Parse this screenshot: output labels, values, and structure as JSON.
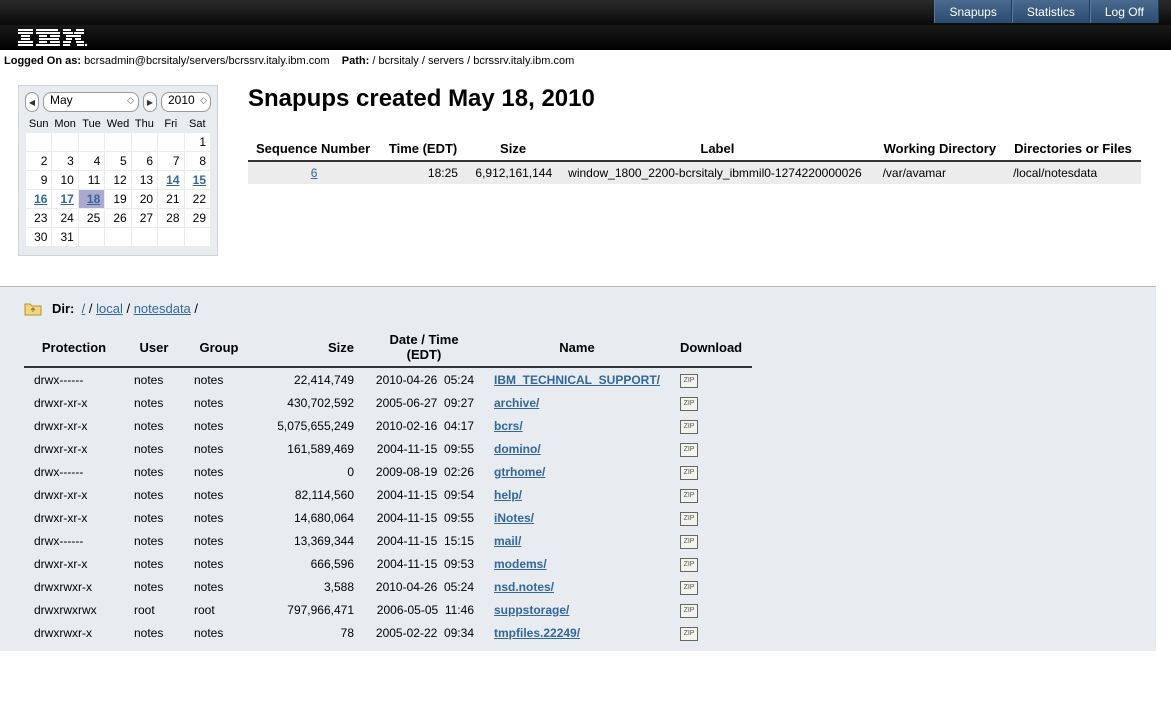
{
  "topnav": {
    "snapups": "Snapups",
    "statistics": "Statistics",
    "logoff": "Log Off"
  },
  "infobar": {
    "logged_label": "Logged On as:",
    "logged_value": "bcrsadmin@bcrsitaly/servers/bcrssrv.italy.ibm.com",
    "path_label": "Path:",
    "path_value": "/ bcrsitaly / servers / bcrssrv.italy.ibm.com"
  },
  "calendar": {
    "month": "May",
    "year": "2010",
    "days": [
      "Sun",
      "Mon",
      "Tue",
      "Wed",
      "Thu",
      "Fri",
      "Sat"
    ],
    "weeks": [
      [
        "",
        "",
        "",
        "",
        "",
        "",
        "1"
      ],
      [
        "2",
        "3",
        "4",
        "5",
        "6",
        "7",
        "8"
      ],
      [
        "9",
        "10",
        "11",
        "12",
        "13",
        "14",
        "15"
      ],
      [
        "16",
        "17",
        "18",
        "19",
        "20",
        "21",
        "22"
      ],
      [
        "23",
        "24",
        "25",
        "26",
        "27",
        "28",
        "29"
      ],
      [
        "30",
        "31",
        "",
        "",
        "",
        "",
        ""
      ]
    ],
    "linked": [
      "14",
      "15",
      "16",
      "17",
      "18"
    ],
    "selected": "18"
  },
  "snapups": {
    "title": "Snapups created May 18, 2010",
    "headers": {
      "seq": "Sequence Number",
      "time": "Time (EDT)",
      "size": "Size",
      "label": "Label",
      "workdir": "Working Directory",
      "dirs": "Directories or Files"
    },
    "rows": [
      {
        "seq": "6",
        "time": "18:25",
        "size": "6,912,161,144",
        "label": "window_1800_2200-bcrsitaly_ibmmil0-1274220000026",
        "workdir": "/var/avamar",
        "dirs": "/local/notesdata"
      }
    ]
  },
  "filebrowser": {
    "dir_label": "Dir:",
    "breadcrumb": [
      {
        "text": "/",
        "link": true
      },
      {
        "text": "/",
        "link": false
      },
      {
        "text": "local",
        "link": true
      },
      {
        "text": "/",
        "link": false
      },
      {
        "text": "notesdata",
        "link": true
      },
      {
        "text": "/",
        "link": false
      }
    ],
    "headers": {
      "protection": "Protection",
      "user": "User",
      "group": "Group",
      "size": "Size",
      "datetime": "Date / Time (EDT)",
      "name": "Name",
      "download": "Download"
    },
    "rows": [
      {
        "protection": "drwx------",
        "user": "notes",
        "group": "notes",
        "size": "22,414,749",
        "date": "2010-04-26",
        "time": "05:24",
        "name": "IBM_TECHNICAL_SUPPORT/"
      },
      {
        "protection": "drwxr-xr-x",
        "user": "notes",
        "group": "notes",
        "size": "430,702,592",
        "date": "2005-06-27",
        "time": "09:27",
        "name": "archive/"
      },
      {
        "protection": "drwxr-xr-x",
        "user": "notes",
        "group": "notes",
        "size": "5,075,655,249",
        "date": "2010-02-16",
        "time": "04:17",
        "name": "bcrs/"
      },
      {
        "protection": "drwxr-xr-x",
        "user": "notes",
        "group": "notes",
        "size": "161,589,469",
        "date": "2004-11-15",
        "time": "09:55",
        "name": "domino/"
      },
      {
        "protection": "drwx------",
        "user": "notes",
        "group": "notes",
        "size": "0",
        "date": "2009-08-19",
        "time": "02:26",
        "name": "gtrhome/"
      },
      {
        "protection": "drwxr-xr-x",
        "user": "notes",
        "group": "notes",
        "size": "82,114,560",
        "date": "2004-11-15",
        "time": "09:54",
        "name": "help/"
      },
      {
        "protection": "drwxr-xr-x",
        "user": "notes",
        "group": "notes",
        "size": "14,680,064",
        "date": "2004-11-15",
        "time": "09:55",
        "name": "iNotes/"
      },
      {
        "protection": "drwx------",
        "user": "notes",
        "group": "notes",
        "size": "13,369,344",
        "date": "2004-11-15",
        "time": "15:15",
        "name": "mail/"
      },
      {
        "protection": "drwxr-xr-x",
        "user": "notes",
        "group": "notes",
        "size": "666,596",
        "date": "2004-11-15",
        "time": "09:53",
        "name": "modems/"
      },
      {
        "protection": "drwxrwxr-x",
        "user": "notes",
        "group": "notes",
        "size": "3,588",
        "date": "2010-04-26",
        "time": "05:24",
        "name": "nsd.notes/"
      },
      {
        "protection": "drwxrwxrwx",
        "user": "root",
        "group": "root",
        "size": "797,966,471",
        "date": "2006-05-05",
        "time": "11:46",
        "name": "suppstorage/"
      },
      {
        "protection": "drwxrwxr-x",
        "user": "notes",
        "group": "notes",
        "size": "78",
        "date": "2005-02-22",
        "time": "09:34",
        "name": "tmpfiles.22249/"
      }
    ]
  }
}
